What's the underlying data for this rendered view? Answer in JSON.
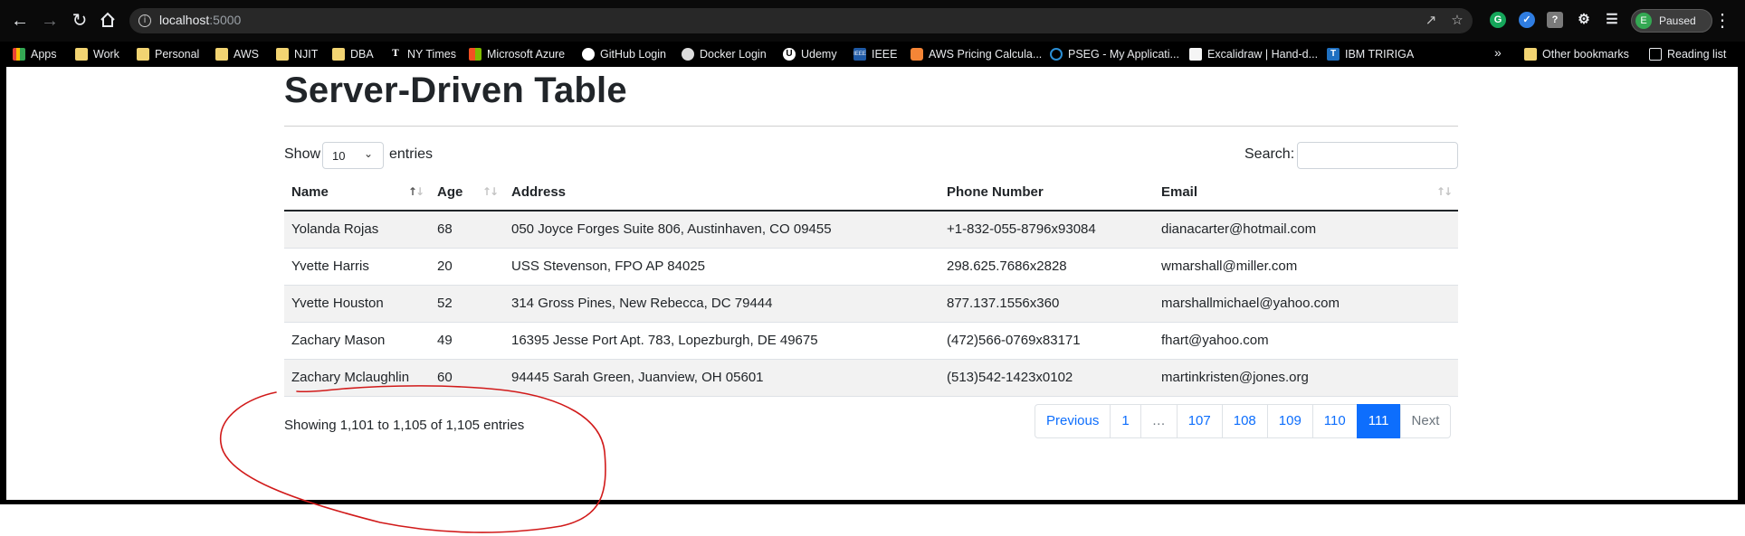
{
  "browser": {
    "url_host": "localhost",
    "url_port": ":5000",
    "profile_initial": "E",
    "profile_status": "Paused"
  },
  "bookmarks": {
    "items": [
      "Apps",
      "Work",
      "Personal",
      "AWS",
      "NJIT",
      "DBA",
      "NY Times",
      "Microsoft Azure",
      "GitHub Login",
      "Docker Login",
      "Udemy",
      "IEEE",
      "AWS Pricing Calcula...",
      "PSEG - My Applicati...",
      "Excalidraw | Hand-d...",
      "IBM TRIRIGA"
    ],
    "overflow": "»",
    "other": "Other bookmarks",
    "reading_list": "Reading list"
  },
  "page": {
    "title": "Server-Driven Table",
    "show_label": "Show",
    "entries_label": "entries",
    "length_value": "10",
    "search_label": "Search:",
    "search_value": "",
    "columns": [
      "Name",
      "Age",
      "Address",
      "Phone Number",
      "Email"
    ],
    "rows": [
      [
        "Yolanda Rojas",
        "68",
        "050 Joyce Forges Suite 806, Austinhaven, CO 09455",
        "+1-832-055-8796x93084",
        "dianacarter@hotmail.com"
      ],
      [
        "Yvette Harris",
        "20",
        "USS Stevenson, FPO AP 84025",
        "298.625.7686x2828",
        "wmarshall@miller.com"
      ],
      [
        "Yvette Houston",
        "52",
        "314 Gross Pines, New Rebecca, DC 79444",
        "877.137.1556x360",
        "marshallmichael@yahoo.com"
      ],
      [
        "Zachary Mason",
        "49",
        "16395 Jesse Port Apt. 783, Lopezburgh, DE 49675",
        "(472)566-0769x83171",
        "fhart@yahoo.com"
      ],
      [
        "Zachary Mclaughlin",
        "60",
        "94445 Sarah Green, Juanview, OH 05601",
        "(513)542-1423x0102",
        "martinkristen@jones.org"
      ]
    ],
    "info": "Showing 1,101 to 1,105 of 1,105 entries",
    "pagination": {
      "previous": "Previous",
      "pages": [
        "1",
        "…",
        "107",
        "108",
        "109",
        "110",
        "111"
      ],
      "active": "111",
      "next": "Next"
    }
  },
  "colors": {
    "accent": "#0d6efd",
    "annotation": "#d11a1a"
  }
}
